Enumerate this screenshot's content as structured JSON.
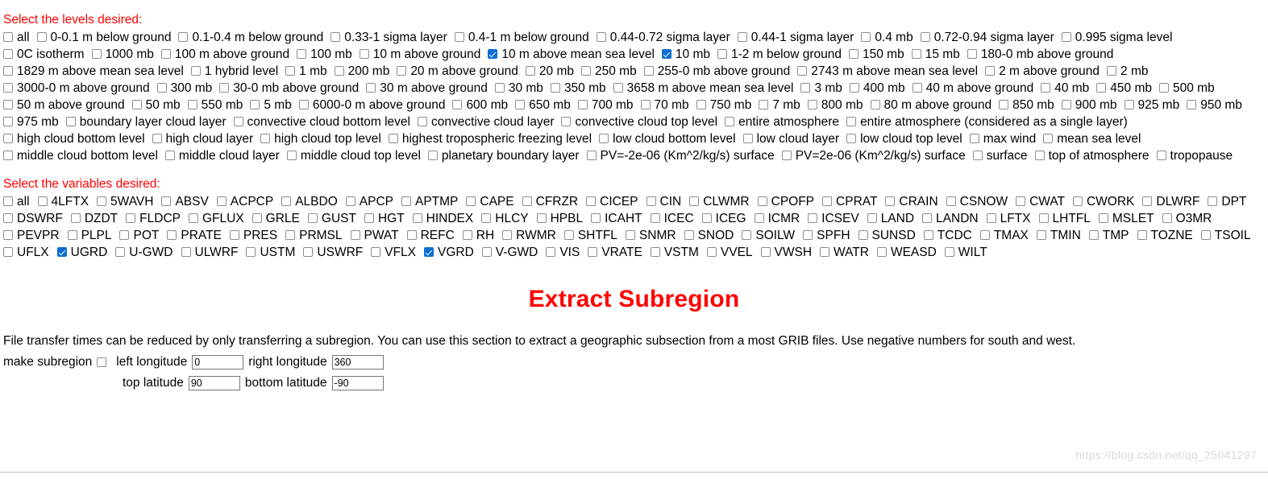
{
  "levels": {
    "heading": "Select the levels desired:",
    "items": [
      {
        "label": "all",
        "checked": false
      },
      {
        "label": "0-0.1 m below ground",
        "checked": false
      },
      {
        "label": "0.1-0.4 m below ground",
        "checked": false
      },
      {
        "label": "0.33-1 sigma layer",
        "checked": false
      },
      {
        "label": "0.4-1 m below ground",
        "checked": false
      },
      {
        "label": "0.44-0.72 sigma layer",
        "checked": false
      },
      {
        "label": "0.44-1 sigma layer",
        "checked": false
      },
      {
        "label": "0.4 mb",
        "checked": false
      },
      {
        "label": "0.72-0.94 sigma layer",
        "checked": false
      },
      {
        "label": "0.995 sigma level",
        "checked": false
      },
      {
        "label": "0C isotherm",
        "checked": false
      },
      {
        "label": "1000 mb",
        "checked": false
      },
      {
        "label": "100 m above ground",
        "checked": false
      },
      {
        "label": "100 mb",
        "checked": false
      },
      {
        "label": "10 m above ground",
        "checked": false
      },
      {
        "label": "10 m above mean sea level",
        "checked": true
      },
      {
        "label": "10 mb",
        "checked": true
      },
      {
        "label": "1-2 m below ground",
        "checked": false
      },
      {
        "label": "150 mb",
        "checked": false
      },
      {
        "label": "15 mb",
        "checked": false
      },
      {
        "label": "180-0 mb above ground",
        "checked": false
      },
      {
        "label": "1829 m above mean sea level",
        "checked": false
      },
      {
        "label": "1 hybrid level",
        "checked": false
      },
      {
        "label": "1 mb",
        "checked": false
      },
      {
        "label": "200 mb",
        "checked": false
      },
      {
        "label": "20 m above ground",
        "checked": false
      },
      {
        "label": "20 mb",
        "checked": false
      },
      {
        "label": "250 mb",
        "checked": false
      },
      {
        "label": "255-0 mb above ground",
        "checked": false
      },
      {
        "label": "2743 m above mean sea level",
        "checked": false
      },
      {
        "label": "2 m above ground",
        "checked": false
      },
      {
        "label": "2 mb",
        "checked": false
      },
      {
        "label": "3000-0 m above ground",
        "checked": false
      },
      {
        "label": "300 mb",
        "checked": false
      },
      {
        "label": "30-0 mb above ground",
        "checked": false
      },
      {
        "label": "30 m above ground",
        "checked": false
      },
      {
        "label": "30 mb",
        "checked": false
      },
      {
        "label": "350 mb",
        "checked": false
      },
      {
        "label": "3658 m above mean sea level",
        "checked": false
      },
      {
        "label": "3 mb",
        "checked": false
      },
      {
        "label": "400 mb",
        "checked": false
      },
      {
        "label": "40 m above ground",
        "checked": false
      },
      {
        "label": "40 mb",
        "checked": false
      },
      {
        "label": "450 mb",
        "checked": false
      },
      {
        "label": "500 mb",
        "checked": false
      },
      {
        "label": "50 m above ground",
        "checked": false
      },
      {
        "label": "50 mb",
        "checked": false
      },
      {
        "label": "550 mb",
        "checked": false
      },
      {
        "label": "5 mb",
        "checked": false
      },
      {
        "label": "6000-0 m above ground",
        "checked": false
      },
      {
        "label": "600 mb",
        "checked": false
      },
      {
        "label": "650 mb",
        "checked": false
      },
      {
        "label": "700 mb",
        "checked": false
      },
      {
        "label": "70 mb",
        "checked": false
      },
      {
        "label": "750 mb",
        "checked": false
      },
      {
        "label": "7 mb",
        "checked": false
      },
      {
        "label": "800 mb",
        "checked": false
      },
      {
        "label": "80 m above ground",
        "checked": false
      },
      {
        "label": "850 mb",
        "checked": false
      },
      {
        "label": "900 mb",
        "checked": false
      },
      {
        "label": "925 mb",
        "checked": false
      },
      {
        "label": "950 mb",
        "checked": false
      },
      {
        "label": "975 mb",
        "checked": false
      },
      {
        "label": "boundary layer cloud layer",
        "checked": false
      },
      {
        "label": "convective cloud bottom level",
        "checked": false
      },
      {
        "label": "convective cloud layer",
        "checked": false
      },
      {
        "label": "convective cloud top level",
        "checked": false
      },
      {
        "label": "entire atmosphere",
        "checked": false
      },
      {
        "label": "entire atmosphere (considered as a single layer)",
        "checked": false
      },
      {
        "label": "high cloud bottom level",
        "checked": false
      },
      {
        "label": "high cloud layer",
        "checked": false
      },
      {
        "label": "high cloud top level",
        "checked": false
      },
      {
        "label": "highest tropospheric freezing level",
        "checked": false
      },
      {
        "label": "low cloud bottom level",
        "checked": false
      },
      {
        "label": "low cloud layer",
        "checked": false
      },
      {
        "label": "low cloud top level",
        "checked": false
      },
      {
        "label": "max wind",
        "checked": false
      },
      {
        "label": "mean sea level",
        "checked": false
      },
      {
        "label": "middle cloud bottom level",
        "checked": false
      },
      {
        "label": "middle cloud layer",
        "checked": false
      },
      {
        "label": "middle cloud top level",
        "checked": false
      },
      {
        "label": "planetary boundary layer",
        "checked": false
      },
      {
        "label": "PV=-2e-06 (Km^2/kg/s) surface",
        "checked": false
      },
      {
        "label": "PV=2e-06 (Km^2/kg/s) surface",
        "checked": false
      },
      {
        "label": "surface",
        "checked": false
      },
      {
        "label": "top of atmosphere",
        "checked": false
      },
      {
        "label": "tropopause",
        "checked": false
      }
    ]
  },
  "variables": {
    "heading": "Select the variables desired:",
    "items": [
      {
        "label": "all",
        "checked": false
      },
      {
        "label": "4LFTX",
        "checked": false
      },
      {
        "label": "5WAVH",
        "checked": false
      },
      {
        "label": "ABSV",
        "checked": false
      },
      {
        "label": "ACPCP",
        "checked": false
      },
      {
        "label": "ALBDO",
        "checked": false
      },
      {
        "label": "APCP",
        "checked": false
      },
      {
        "label": "APTMP",
        "checked": false
      },
      {
        "label": "CAPE",
        "checked": false
      },
      {
        "label": "CFRZR",
        "checked": false
      },
      {
        "label": "CICEP",
        "checked": false
      },
      {
        "label": "CIN",
        "checked": false
      },
      {
        "label": "CLWMR",
        "checked": false
      },
      {
        "label": "CPOFP",
        "checked": false
      },
      {
        "label": "CPRAT",
        "checked": false
      },
      {
        "label": "CRAIN",
        "checked": false
      },
      {
        "label": "CSNOW",
        "checked": false
      },
      {
        "label": "CWAT",
        "checked": false
      },
      {
        "label": "CWORK",
        "checked": false
      },
      {
        "label": "DLWRF",
        "checked": false
      },
      {
        "label": "DPT",
        "checked": false
      },
      {
        "label": "DSWRF",
        "checked": false
      },
      {
        "label": "DZDT",
        "checked": false
      },
      {
        "label": "FLDCP",
        "checked": false
      },
      {
        "label": "GFLUX",
        "checked": false
      },
      {
        "label": "GRLE",
        "checked": false
      },
      {
        "label": "GUST",
        "checked": false
      },
      {
        "label": "HGT",
        "checked": false
      },
      {
        "label": "HINDEX",
        "checked": false
      },
      {
        "label": "HLCY",
        "checked": false
      },
      {
        "label": "HPBL",
        "checked": false
      },
      {
        "label": "ICAHT",
        "checked": false
      },
      {
        "label": "ICEC",
        "checked": false
      },
      {
        "label": "ICEG",
        "checked": false
      },
      {
        "label": "ICMR",
        "checked": false
      },
      {
        "label": "ICSEV",
        "checked": false
      },
      {
        "label": "LAND",
        "checked": false
      },
      {
        "label": "LANDN",
        "checked": false
      },
      {
        "label": "LFTX",
        "checked": false
      },
      {
        "label": "LHTFL",
        "checked": false
      },
      {
        "label": "MSLET",
        "checked": false
      },
      {
        "label": "O3MR",
        "checked": false
      },
      {
        "label": "PEVPR",
        "checked": false
      },
      {
        "label": "PLPL",
        "checked": false
      },
      {
        "label": "POT",
        "checked": false
      },
      {
        "label": "PRATE",
        "checked": false
      },
      {
        "label": "PRES",
        "checked": false
      },
      {
        "label": "PRMSL",
        "checked": false
      },
      {
        "label": "PWAT",
        "checked": false
      },
      {
        "label": "REFC",
        "checked": false
      },
      {
        "label": "RH",
        "checked": false
      },
      {
        "label": "RWMR",
        "checked": false
      },
      {
        "label": "SHTFL",
        "checked": false
      },
      {
        "label": "SNMR",
        "checked": false
      },
      {
        "label": "SNOD",
        "checked": false
      },
      {
        "label": "SOILW",
        "checked": false
      },
      {
        "label": "SPFH",
        "checked": false
      },
      {
        "label": "SUNSD",
        "checked": false
      },
      {
        "label": "TCDC",
        "checked": false
      },
      {
        "label": "TMAX",
        "checked": false
      },
      {
        "label": "TMIN",
        "checked": false
      },
      {
        "label": "TMP",
        "checked": false
      },
      {
        "label": "TOZNE",
        "checked": false
      },
      {
        "label": "TSOIL",
        "checked": false
      },
      {
        "label": "UFLX",
        "checked": false
      },
      {
        "label": "UGRD",
        "checked": true
      },
      {
        "label": "U-GWD",
        "checked": false
      },
      {
        "label": "ULWRF",
        "checked": false
      },
      {
        "label": "USTM",
        "checked": false
      },
      {
        "label": "USWRF",
        "checked": false
      },
      {
        "label": "VFLX",
        "checked": false
      },
      {
        "label": "VGRD",
        "checked": true
      },
      {
        "label": "V-GWD",
        "checked": false
      },
      {
        "label": "VIS",
        "checked": false
      },
      {
        "label": "VRATE",
        "checked": false
      },
      {
        "label": "VSTM",
        "checked": false
      },
      {
        "label": "VVEL",
        "checked": false
      },
      {
        "label": "VWSH",
        "checked": false
      },
      {
        "label": "WATR",
        "checked": false
      },
      {
        "label": "WEASD",
        "checked": false
      },
      {
        "label": "WILT",
        "checked": false
      }
    ]
  },
  "extract_subregion": {
    "title": "Extract Subregion",
    "description": "File transfer times can be reduced by only transferring a subregion. You can use this section to extract a geographic subsection from a most GRIB files. Use negative numbers for south and west.",
    "make_subregion_label": "make subregion",
    "make_subregion_checked": false,
    "fields": {
      "left_longitude_label": "left longitude",
      "left_longitude_value": "0",
      "right_longitude_label": "right longitude",
      "right_longitude_value": "360",
      "top_latitude_label": "top latitude",
      "top_latitude_value": "90",
      "bottom_latitude_label": "bottom latitude",
      "bottom_latitude_value": "-90"
    }
  },
  "watermark": "https://blog.csdn.net/qq_25041297",
  "colors": {
    "heading_red": "#ff0000",
    "checkbox_checked": "#0a6ed1",
    "text": "#000000"
  }
}
